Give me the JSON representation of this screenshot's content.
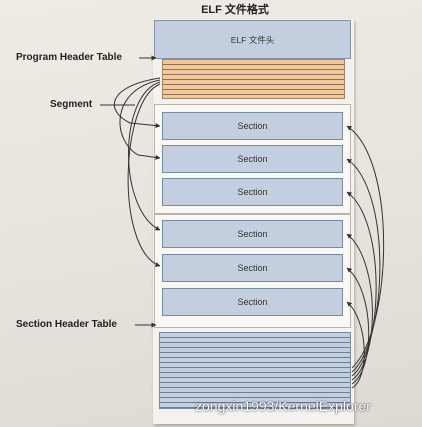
{
  "title": "ELF 文件格式",
  "elf_header": {
    "label": "ELF 文件头"
  },
  "labels": {
    "program_header_table": "Program Header Table",
    "segment": "Segment",
    "section_header_table": "Section Header Table"
  },
  "sections": [
    {
      "label": "Section"
    },
    {
      "label": "Section"
    },
    {
      "label": "Section"
    },
    {
      "label": "Section"
    },
    {
      "label": "Section"
    },
    {
      "label": "Section"
    }
  ],
  "watermark": "zongxin1993/KernelExplorer",
  "colors": {
    "header_fill": "#c3cfdf",
    "program_header_fill": "#f2c89a",
    "segment_fill": "#f9f8f5",
    "arrow": "#333333"
  }
}
